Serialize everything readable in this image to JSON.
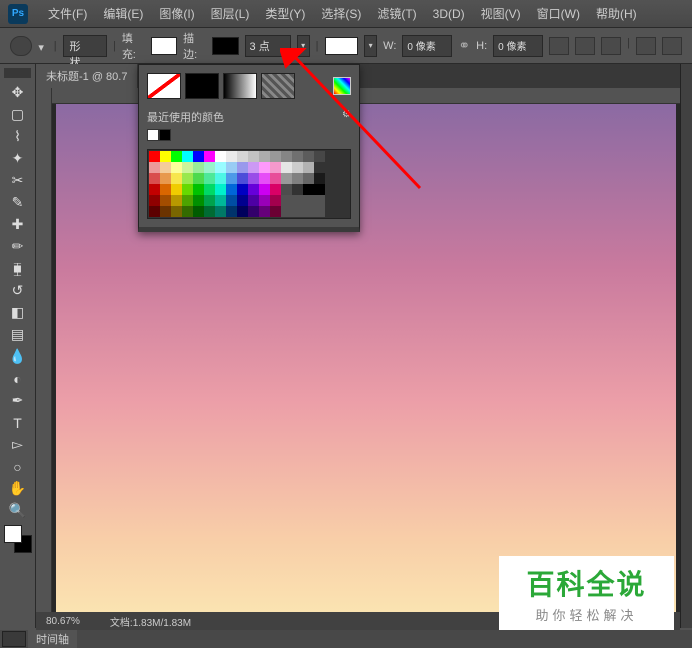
{
  "app_logo": "Ps",
  "menu": [
    "文件(F)",
    "编辑(E)",
    "图像(I)",
    "图层(L)",
    "类型(Y)",
    "选择(S)",
    "滤镜(T)",
    "3D(D)",
    "视图(V)",
    "窗口(W)",
    "帮助(H)"
  ],
  "options": {
    "shape_mode": "形状",
    "fill_label": "填充:",
    "stroke_label": "描边:",
    "stroke_width": "3 点",
    "w_label": "W:",
    "w_value": "0 像素",
    "h_label": "H:",
    "h_value": "0 像素"
  },
  "doc": {
    "tab_title": "未标题-1 @ 80.7"
  },
  "color_popup": {
    "recent_label": "最近使用的颜色",
    "recent": [
      "#ffffff",
      "#000000"
    ],
    "grid": [
      "#ff0000",
      "#ffff00",
      "#00ff00",
      "#00ffff",
      "#0000ff",
      "#ff00ff",
      "#ffffff",
      "#ebebeb",
      "#d6d6d6",
      "#c2c2c2",
      "#adadad",
      "#999999",
      "#858585",
      "#707070",
      "#5c5c5c",
      "#474747",
      "#ec9999",
      "#f4cc99",
      "#fcff99",
      "#ccf499",
      "#99ec99",
      "#99f4cc",
      "#99fcff",
      "#99ccf4",
      "#9999ec",
      "#cc99f4",
      "#ff99fc",
      "#f499cc",
      "#e5e5e5",
      "#cccccc",
      "#b2b2b2",
      "#333333",
      "#d94d4d",
      "#e8994d",
      "#f7e64d",
      "#99e84d",
      "#4dd94d",
      "#4de899",
      "#4df7e6",
      "#4d99e8",
      "#4d4dd9",
      "#994de8",
      "#e64df7",
      "#e84d99",
      "#999999",
      "#808080",
      "#666666",
      "#1a1a1a",
      "#c20000",
      "#d96600",
      "#f0cc00",
      "#66d900",
      "#00c200",
      "#00d966",
      "#00f0cc",
      "#0066d9",
      "#0000c2",
      "#6600d9",
      "#cc00f0",
      "#d90066",
      "#4d4d4d",
      "#333333",
      "#000000",
      "#000000",
      "#8f0000",
      "#a34d00",
      "#b89900",
      "#4da300",
      "#008f00",
      "#00a34d",
      "#00b899",
      "#004da3",
      "#00008f",
      "#4d00a3",
      "#9900b8",
      "#a3004d",
      "",
      "",
      "",
      "",
      "#5c0000",
      "#6b3300",
      "#7a6600",
      "#336b00",
      "#005c00",
      "#006b33",
      "#007a66",
      "#00336b",
      "#00005c",
      "#33006b",
      "#66007a",
      "#6b0033",
      "",
      "",
      "",
      ""
    ]
  },
  "status": {
    "zoom": "80.67%",
    "docinfo": "文档:1.83M/1.83M"
  },
  "bottom": {
    "timeline": "时间轴"
  },
  "watermark": {
    "title": "百科全说",
    "sub": "助你轻松解决"
  }
}
